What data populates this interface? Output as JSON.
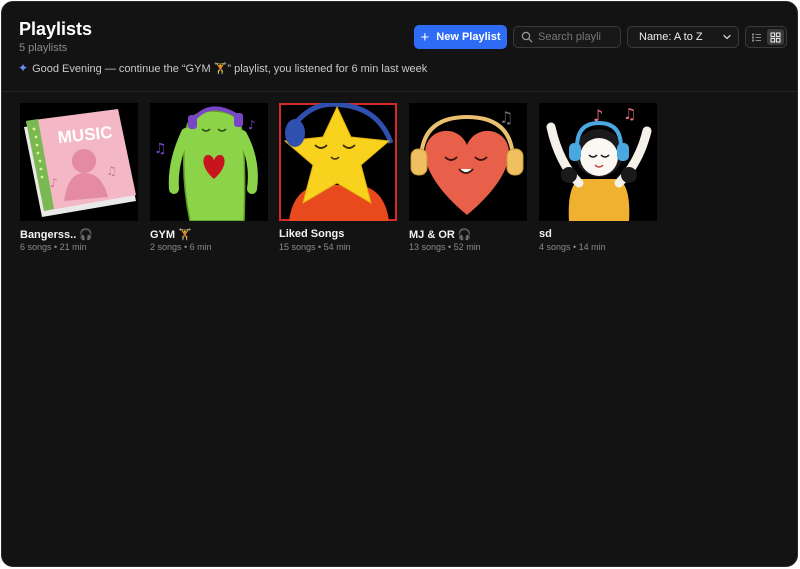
{
  "header": {
    "title": "Playlists",
    "count": "5 playlists",
    "greeting_icon": "sparkles-icon",
    "greeting": "Good Evening — continue the “GYM 🏋” playlist, you listened for 6 min last week"
  },
  "toolbar": {
    "new_playlist_label": "New Playlist",
    "search_placeholder": "Search playli",
    "sort_value": "Name: A to Z",
    "accent_color": "#2f6cf6"
  },
  "playlists": [
    {
      "name": "Bangerss.. 🎧",
      "meta": "6 songs • 21 min",
      "cover": "music-book-cover"
    },
    {
      "name": "GYM 🏋",
      "meta": "2 songs • 6 min",
      "cover": "green-character-heart-cover"
    },
    {
      "name": "Liked Songs",
      "meta": "15 songs • 54 min",
      "cover": "star-headphones-cover"
    },
    {
      "name": "MJ & OR 🎧",
      "meta": "13 songs • 52 min",
      "cover": "heart-headphones-cover"
    },
    {
      "name": "sd",
      "meta": "4 songs • 14 min",
      "cover": "girl-headphones-cover"
    }
  ]
}
